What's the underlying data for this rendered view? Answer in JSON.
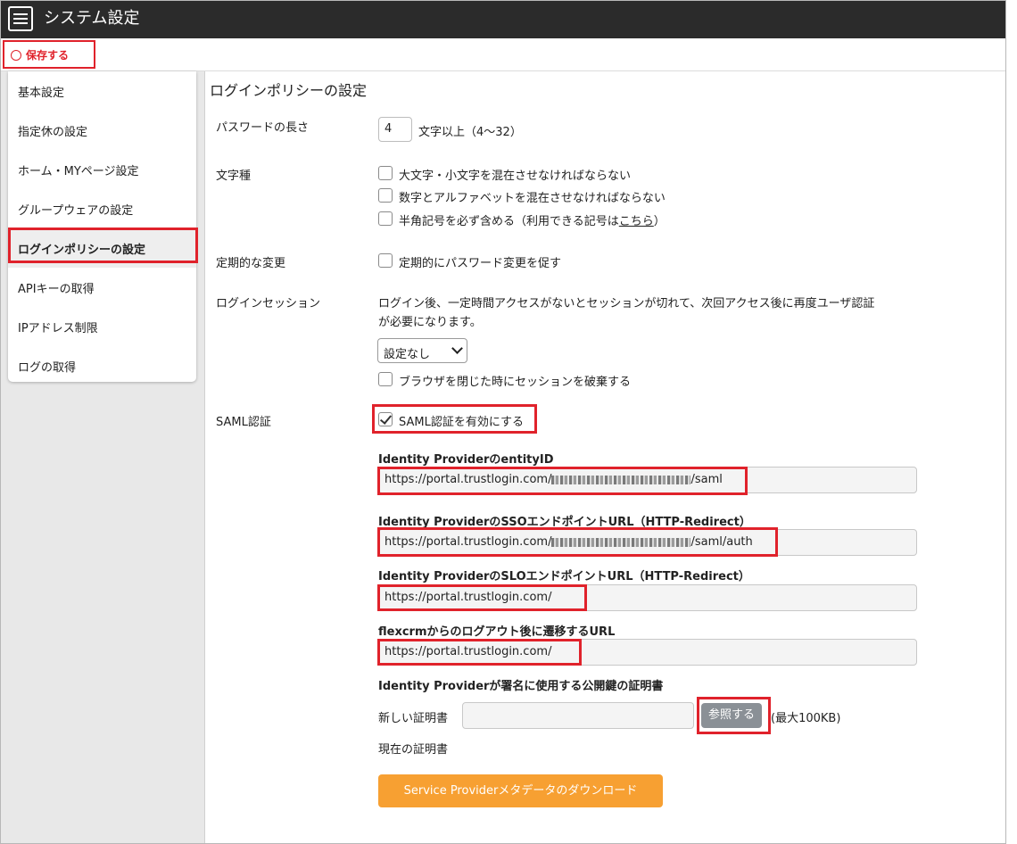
{
  "header": {
    "title": "システム設定",
    "menu_icon": "hamburger-menu-icon"
  },
  "toolbar": {
    "save_label": "保存する",
    "save_icon": "circle-icon",
    "accent_color": "#e0222b"
  },
  "sidebar": {
    "items": [
      {
        "label": "基本設定"
      },
      {
        "label": "指定休の設定"
      },
      {
        "label": "ホーム・MYページ設定"
      },
      {
        "label": "グループウェアの設定"
      },
      {
        "label": "ログインポリシーの設定",
        "active": true
      },
      {
        "label": "APIキーの取得"
      },
      {
        "label": "IPアドレス制限"
      },
      {
        "label": "ログの取得"
      }
    ]
  },
  "main": {
    "title": "ログインポリシーの設定",
    "password_length": {
      "label": "パスワードの長さ",
      "value": "4",
      "suffix": "文字以上（4～32）"
    },
    "char_types": {
      "label": "文字種",
      "options": [
        {
          "label": "大文字・小文字を混在させなければならない",
          "checked": false
        },
        {
          "label": "数字とアルファベットを混在させなければならない",
          "checked": false
        },
        {
          "label": "半角記号を必ず含める（利用できる記号は",
          "link": "こちら",
          "tail": "）",
          "checked": false
        }
      ]
    },
    "periodic_change": {
      "label": "定期的な変更",
      "option": "定期的にパスワード変更を促す",
      "checked": false
    },
    "login_session": {
      "label": "ログインセッション",
      "description_line1": "ログイン後、一定時間アクセスがないとセッションが切れて、次回アクセス後に再度ユーザ認証",
      "description_line2": "が必要になります。",
      "select_value": "設定なし",
      "browser_close_option": "ブラウザを閉じた時にセッションを破棄する",
      "browser_close_checked": false
    },
    "saml": {
      "label": "SAML認証",
      "enable_label": "SAML認証を有効にする",
      "enabled": true,
      "entity_id": {
        "title": "Identity ProviderのentityID",
        "prefix": "https://portal.trustlogin.com/",
        "suffix": "/saml"
      },
      "sso_url": {
        "title": "Identity ProviderのSSOエンドポイントURL（HTTP-Redirect）",
        "prefix": "https://portal.trustlogin.com/",
        "suffix": "/saml/auth"
      },
      "slo_url": {
        "title": "Identity ProviderのSLOエンドポイントURL（HTTP-Redirect）",
        "value": "https://portal.trustlogin.com/"
      },
      "logout_url": {
        "title": "flexcrmからのログアウト後に遷移するURL",
        "value": "https://portal.trustlogin.com/"
      },
      "certificate": {
        "title": "Identity Providerが署名に使用する公開鍵の証明書",
        "new_label": "新しい証明書",
        "browse_label": "参照する",
        "max_size": "(最大100KB)",
        "current_label": "現在の証明書"
      },
      "download_label": "Service Providerメタデータのダウンロード"
    }
  }
}
